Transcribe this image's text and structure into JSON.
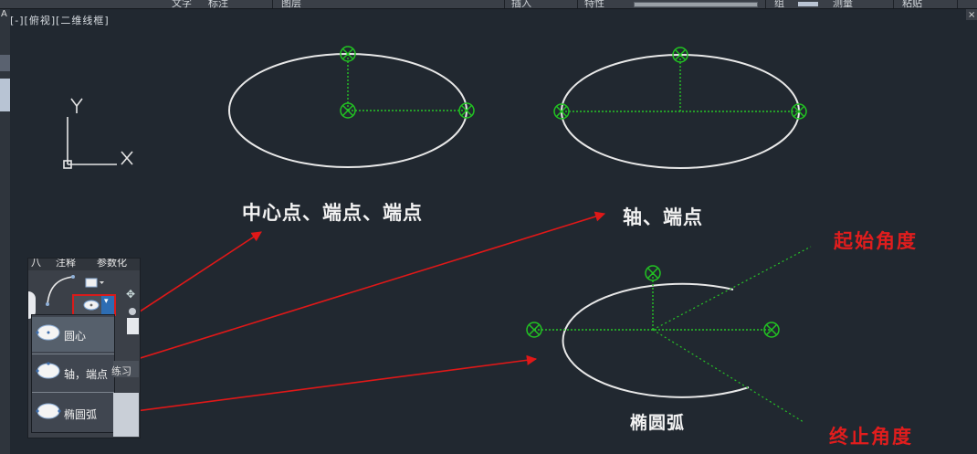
{
  "topbar": {
    "items": [
      "文字",
      "标注",
      "图层",
      "插入",
      "特性",
      "组",
      "测量",
      "粘贴"
    ]
  },
  "viewport": {
    "label": "[-][俯视][二维线框]",
    "ucs": {
      "x_label": "X",
      "y_label": "Y"
    }
  },
  "captions": {
    "center_method": "中心点、端点、端点",
    "axis_method": "轴、端点",
    "elliptical_arc": "椭圆弧",
    "start_angle": "起始角度",
    "end_angle": "终止角度"
  },
  "ribbon": {
    "header_tabs": [
      "八",
      "注释",
      "参数化"
    ],
    "dropdown_glyph": "▾"
  },
  "ellipse_menu": {
    "items": [
      {
        "label": "圆心",
        "icon": "ellipse-center-icon"
      },
      {
        "label": "轴，端点",
        "icon": "ellipse-axis-icon"
      },
      {
        "label": "椭圆弧",
        "icon": "elliptical-arc-icon"
      }
    ]
  },
  "peek": {
    "practice": "练习"
  },
  "colors": {
    "canvas": "#212830",
    "snap_marker": "#22c322",
    "arrow": "#e01818",
    "highlight_box": "#d81b1b"
  }
}
